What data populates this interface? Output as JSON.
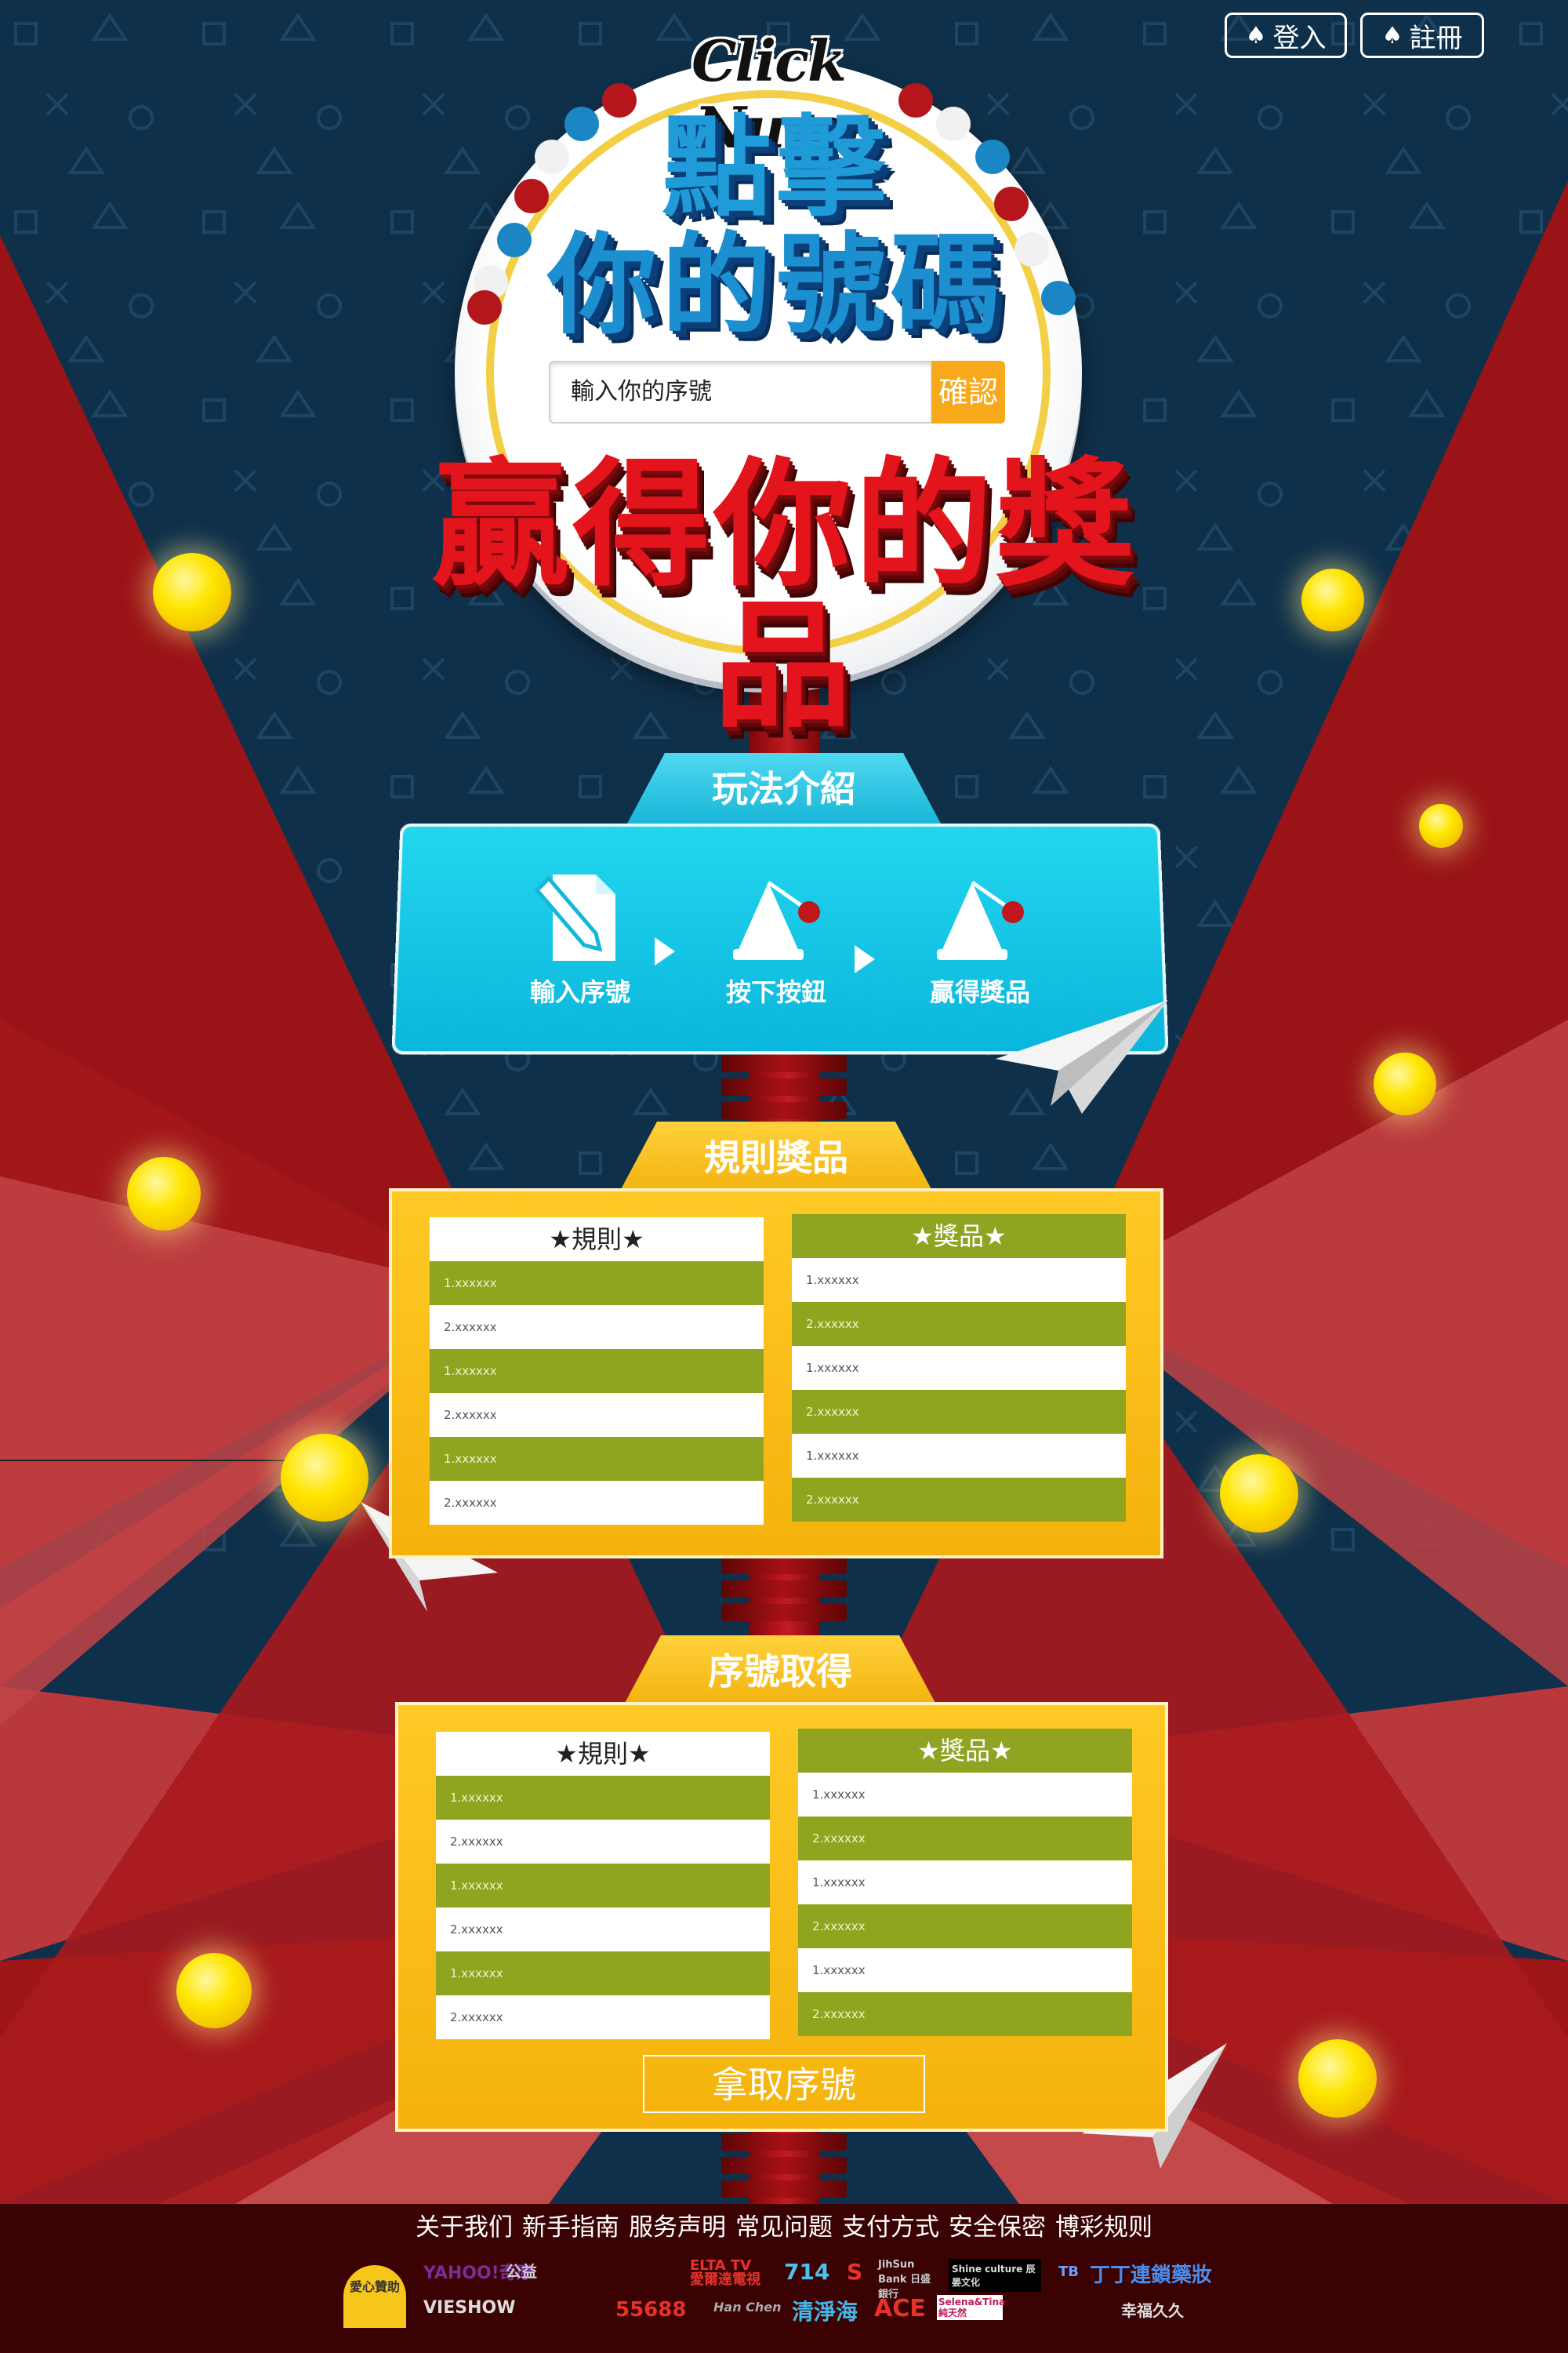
{
  "header": {
    "login_label": "登入",
    "register_label": "註冊"
  },
  "logo": {
    "text": "Click Num"
  },
  "sign": {
    "title_line1": "點擊",
    "title_line2": "你的號碼",
    "serial_placeholder": "輸入你的序號",
    "confirm_label": "確認",
    "win_title": "贏得你的獎品"
  },
  "how": {
    "tab_label": "玩法介紹",
    "steps": [
      {
        "label": "輸入序號",
        "icon": "edit-document-icon"
      },
      {
        "label": "按下按鈕",
        "icon": "bell-button-icon"
      },
      {
        "label": "贏得獎品",
        "icon": "bell-prize-icon"
      }
    ]
  },
  "rules_prizes": {
    "tab_label": "規則獎品",
    "rules_header": "★規則★",
    "prizes_header": "★獎品★",
    "rules_rows": [
      "1.xxxxxx",
      "2.xxxxxx",
      "1.xxxxxx",
      "2.xxxxxx",
      "1.xxxxxx",
      "2.xxxxxx"
    ],
    "prizes_rows": [
      "1.xxxxxx",
      "2.xxxxxx",
      "1.xxxxxx",
      "2.xxxxxx",
      "1.xxxxxx",
      "2.xxxxxx"
    ]
  },
  "serial_section": {
    "tab_label": "序號取得",
    "rules_header": "★規則★",
    "prizes_header": "★獎品★",
    "rules_rows": [
      "1.xxxxxx",
      "2.xxxxxx",
      "1.xxxxxx",
      "2.xxxxxx",
      "1.xxxxxx",
      "2.xxxxxx"
    ],
    "prizes_rows": [
      "1.xxxxxx",
      "2.xxxxxx",
      "1.xxxxxx",
      "2.xxxxxx",
      "1.xxxxxx",
      "2.xxxxxx"
    ],
    "get_button_label": "拿取序號"
  },
  "footer": {
    "links": [
      "关于我们",
      "新手指南",
      "服务声明",
      "常见问题",
      "支付方式",
      "安全保密",
      "博彩规则"
    ],
    "sponsors": [
      "愛心贊助",
      "YAHOO!奇摩",
      "公益",
      "ELTA TV 愛爾達電視",
      "714",
      "S",
      "JihSun Bank 日盛銀行",
      "Shine culture 辰晏文化",
      "TB",
      "丁丁連鎖藥妝",
      "VIESHOW",
      "55688",
      "Han Chen",
      "清淨海",
      "ACE",
      "Selena&Tina 純天然",
      "幸福久久"
    ]
  },
  "colors": {
    "red": "#b3161b",
    "navy": "#0e3049",
    "cyan": "#12c4e4",
    "yellow": "#f7b80f",
    "olive": "#91a41f"
  }
}
